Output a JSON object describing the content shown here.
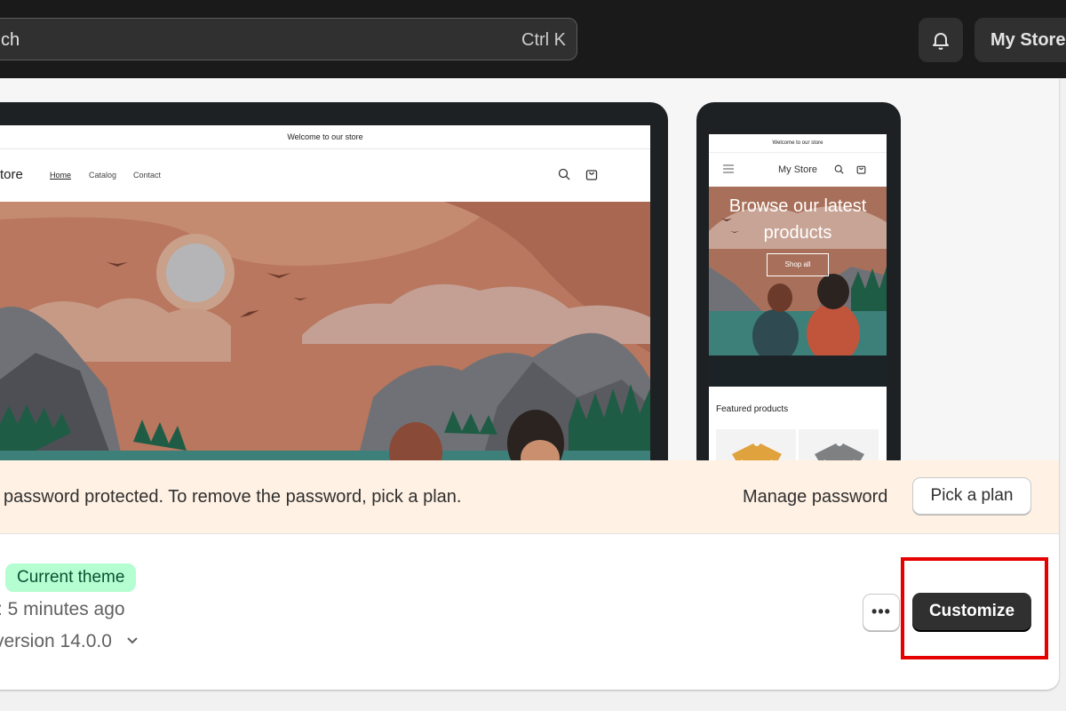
{
  "search": {
    "text": "ch",
    "shortcut": "Ctrl K"
  },
  "header": {
    "bell_icon": "bell-icon",
    "store_label": "My Store"
  },
  "preview": {
    "laptop": {
      "announcement": "Welcome to our store",
      "logo": "tore",
      "nav": [
        "Home",
        "Catalog",
        "Contact"
      ],
      "icons": [
        "search-icon",
        "cart-icon"
      ]
    },
    "phone": {
      "announcement": "Welcome to our store",
      "title": "My Store",
      "hero_heading": "Browse our latest products",
      "shop_button": "Shop all",
      "featured_label": "Featured products",
      "icons": [
        "menu-icon",
        "search-icon",
        "cart-icon"
      ]
    }
  },
  "banner": {
    "message": "password protected. To remove the password, pick a plan.",
    "manage_link": "Manage password",
    "plan_button": "Pick a plan",
    "color": "#fff1e3"
  },
  "theme": {
    "badge": "Current theme",
    "saved": ": 5 minutes ago",
    "version": "version 14.0.0",
    "more_button": "•••",
    "customize_button": "Customize"
  },
  "colors": {
    "topbar": "#1a1a1a",
    "primary_button": "#303030",
    "badge_bg": "#b4fed2",
    "highlight": "#e60000"
  }
}
